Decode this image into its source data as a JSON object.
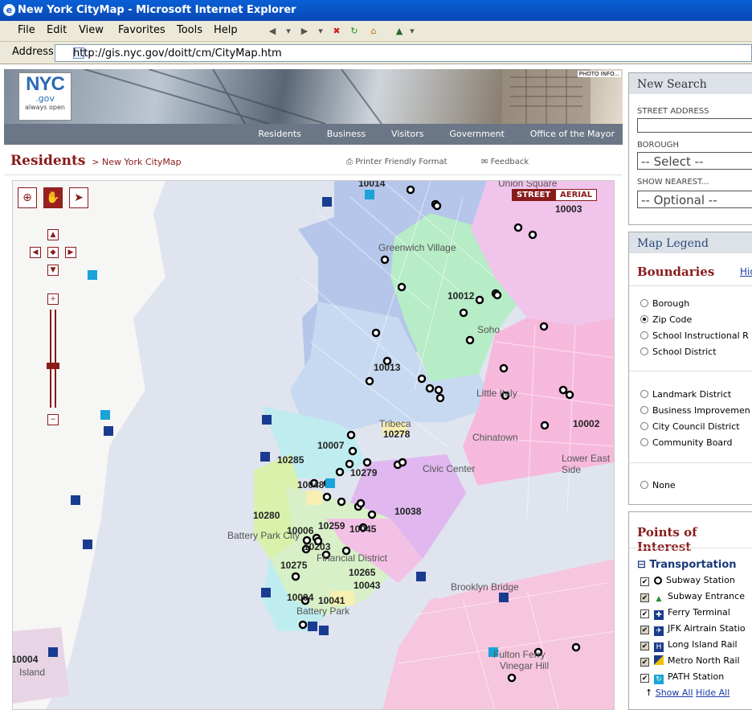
{
  "window": {
    "title": "New York CityMap - Microsoft Internet Explorer"
  },
  "menu": [
    "File",
    "Edit",
    "View",
    "Favorites",
    "Tools",
    "Help"
  ],
  "address": {
    "label": "Address",
    "url": "http://gis.nyc.gov/doitt/cm/CityMap.htm"
  },
  "banner": {
    "logo_nyc": "NYC",
    "logo_gov": ".gov",
    "logo_tag": "always open",
    "photo_info": "PHOTO INFO..."
  },
  "nav": [
    "Residents",
    "Business",
    "Visitors",
    "Government",
    "Office of the Mayor"
  ],
  "breadcrumb": {
    "section": "Residents",
    "page": "> New York CityMap",
    "printer": "Printer Friendly Format",
    "feedback": "Feedback"
  },
  "map": {
    "street_btn": "STREET",
    "aerial_btn": "AERIAL",
    "zip_labels": [
      "10014",
      "10003",
      "10012",
      "10013",
      "10007",
      "10278",
      "10285",
      "10279",
      "10048",
      "10038",
      "10280",
      "10006",
      "10259",
      "10045",
      "10203",
      "10275",
      "10265",
      "10043",
      "10004",
      "10041",
      "10002",
      "10004"
    ],
    "place_labels": [
      "Greenwich Village",
      "Soho",
      "Tribeca",
      "Little Italy",
      "Chinatown",
      "Civic Center",
      "Financial District",
      "Battery Park",
      "Lower East Side",
      "Brooklyn Bridge",
      "Vinegar Hill",
      "Fulton Ferry",
      "Union Square",
      "Battery Park City",
      "Island"
    ],
    "colors": {
      "blue": "#b5c6ea",
      "green": "#b6ecc6",
      "pink": "#f6b9dc",
      "violet": "#e0b7ef",
      "teal": "#bfecef",
      "lime": "#d9f1aa",
      "yellow": "#f6efb1",
      "salmon": "#f9cfd5"
    }
  },
  "search": {
    "title": "New Search",
    "street_label": "STREET ADDRESS",
    "borough_label": "BOROUGH",
    "borough_value": "-- Select --",
    "nearest_label": "SHOW NEAREST...",
    "nearest_value": "-- Optional --"
  },
  "legend": {
    "title": "Map Legend",
    "boundaries_title": "Boundaries",
    "hide_link": "Hid",
    "boundaries": [
      "Borough",
      "Zip Code",
      "School Instructional R",
      "School District"
    ],
    "boundaries2": [
      "Landmark District",
      "Business Improvemen",
      "City Council District",
      "Community Board"
    ],
    "none": "None",
    "poi_title": "Points of Interest",
    "transport_title": "Transportation",
    "transport_items": [
      "Subway Station",
      "Subway Entrance",
      "Ferry Terminal",
      "JFK Airtrain Statio",
      "Long Island Rail",
      "Metro North Rail",
      "PATH Station"
    ],
    "show_all": "Show All",
    "hide_all": "Hide All"
  }
}
